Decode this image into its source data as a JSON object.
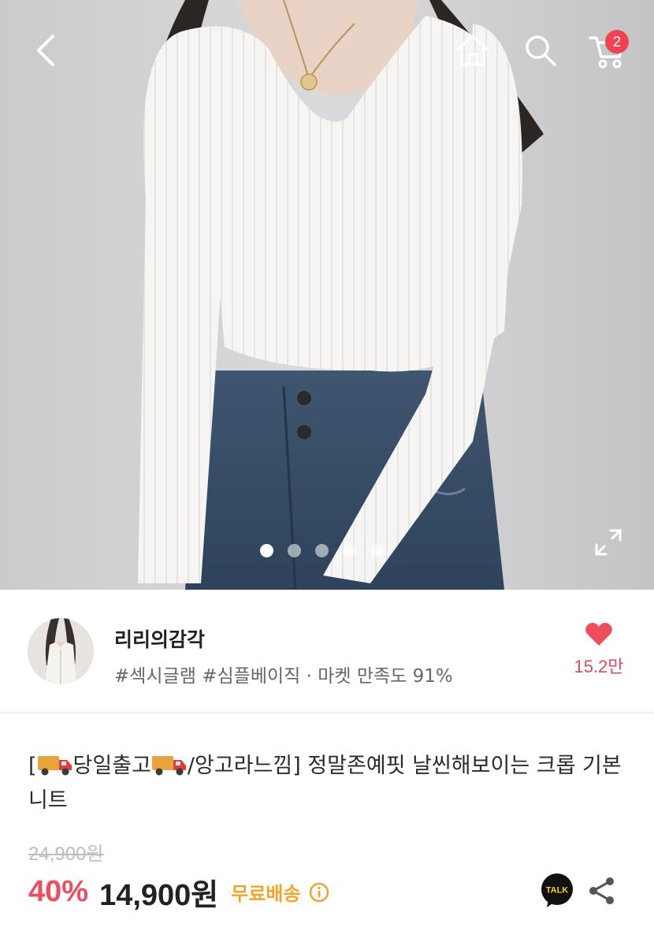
{
  "header": {
    "back_icon": "chevron-left-icon",
    "home_icon": "home-icon",
    "search_icon": "search-icon",
    "cart_icon": "cart-icon",
    "cart_count": "2",
    "badge_color": "#f0424f"
  },
  "gallery": {
    "total_images": 5,
    "active_index": 0,
    "expand_icon": "expand-icon"
  },
  "seller": {
    "name": "리리의감각",
    "meta": "#섹시글램 #심플베이직 · 마켓 만족도 91%",
    "like_icon": "heart-icon",
    "like_count": "15.2만",
    "like_color": "#e1485a"
  },
  "product": {
    "title_prefix": "[",
    "title_part1": "당일출고",
    "title_part2": "/앙고라느낌] 정말존예핏 날씬해보이는 크롭 기본니트",
    "original_price": "24,900원",
    "discount": "40%",
    "discount_color": "#ef4c5e",
    "sale_price": "14,900원",
    "shipping": "무료배송",
    "shipping_color": "#f0a42a",
    "talk_label": "TALK",
    "share_icon": "share-icon"
  }
}
